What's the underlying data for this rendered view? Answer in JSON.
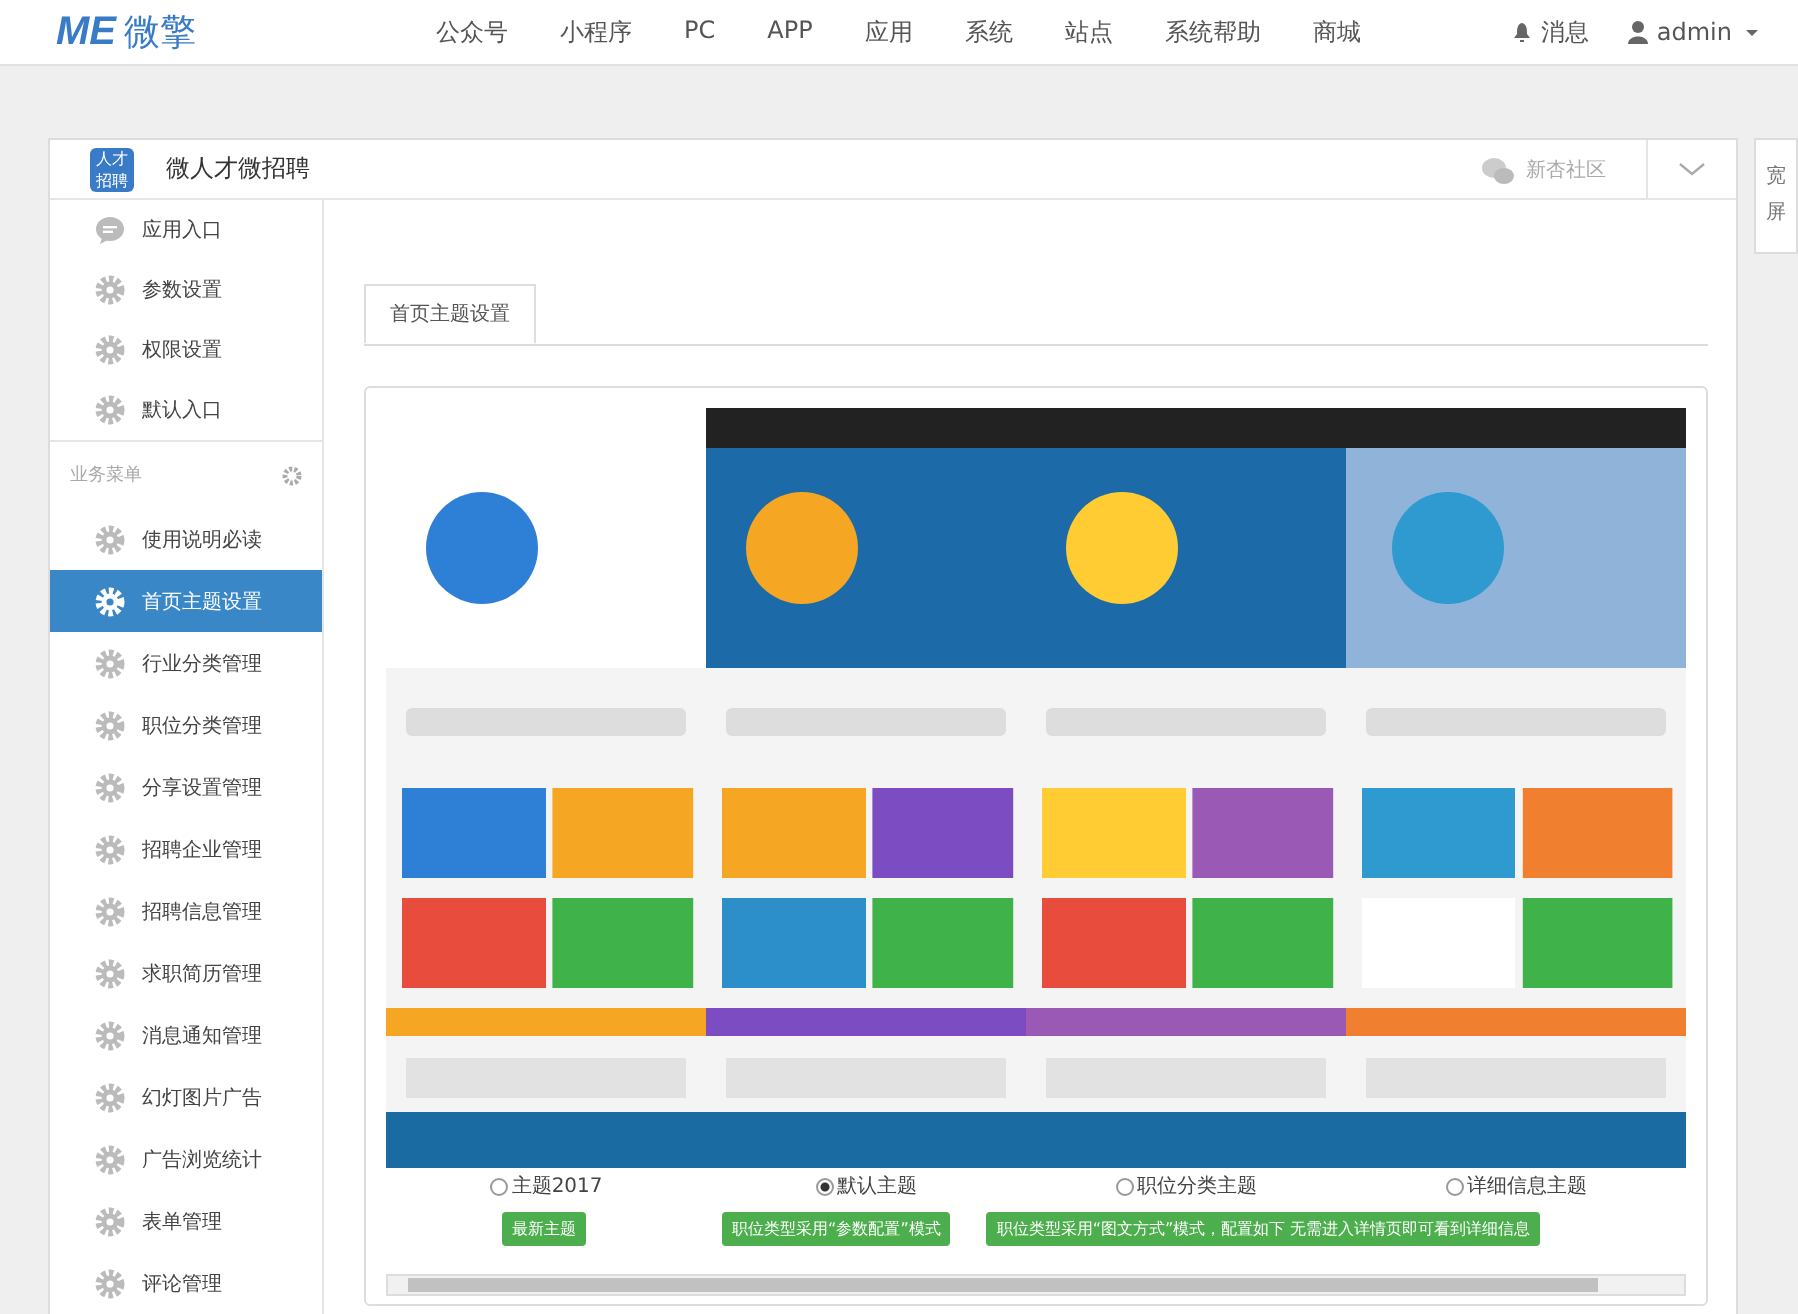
{
  "topbar": {
    "logo_mark": "ME",
    "logo_text": "微擎",
    "nav": [
      "公众号",
      "小程序",
      "PC",
      "APP",
      "应用",
      "系统",
      "站点",
      "系统帮助",
      "商城"
    ],
    "messages": "消息",
    "user": "admin"
  },
  "app": {
    "badge": "人才招聘",
    "title": "微人才微招聘",
    "community": "新杏社区",
    "wide_button": "宽屏"
  },
  "sidebar": {
    "top_items": [
      {
        "label": "应用入口",
        "kind": "chat"
      },
      {
        "label": "参数设置",
        "kind": "gear"
      },
      {
        "label": "权限设置",
        "kind": "gear"
      },
      {
        "label": "默认入口",
        "kind": "gear"
      }
    ],
    "section": "业务菜单",
    "items": [
      {
        "label": "使用说明必读",
        "selected": false
      },
      {
        "label": "首页主题设置",
        "selected": true
      },
      {
        "label": "行业分类管理",
        "selected": false
      },
      {
        "label": "职位分类管理",
        "selected": false
      },
      {
        "label": "分享设置管理",
        "selected": false
      },
      {
        "label": "招聘企业管理",
        "selected": false
      },
      {
        "label": "招聘信息管理",
        "selected": false
      },
      {
        "label": "求职简历管理",
        "selected": false
      },
      {
        "label": "消息通知管理",
        "selected": false
      },
      {
        "label": "幻灯图片广告",
        "selected": false
      },
      {
        "label": "广告浏览统计",
        "selected": false
      },
      {
        "label": "表单管理",
        "selected": false
      },
      {
        "label": "评论管理",
        "selected": false
      }
    ]
  },
  "tabs": [
    {
      "label": "首页主题设置",
      "selected": true
    }
  ],
  "themes": [
    {
      "label": "主题2017",
      "selected": false,
      "note": "最新主题"
    },
    {
      "label": "默认主题",
      "selected": true,
      "note": "职位类型采用“参数配置”模式"
    },
    {
      "label": "职位分类主题",
      "selected": false,
      "note": "职位类型采用“图文方式”模式，配置如下  无需进入详情页即可看到详细信息"
    },
    {
      "label": "详细信息主题",
      "selected": false
    }
  ]
}
